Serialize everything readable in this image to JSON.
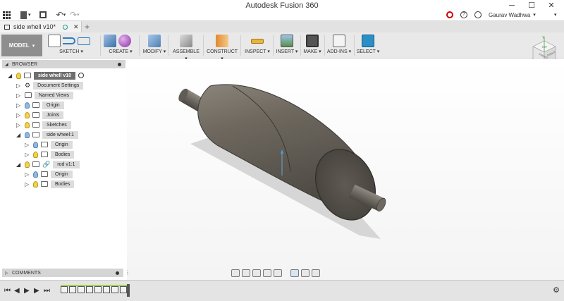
{
  "window": {
    "title": "Autodesk Fusion 360",
    "controls": [
      "minimize",
      "maximize",
      "close"
    ]
  },
  "user": {
    "name": "Gaurav Wadhwa"
  },
  "tabs": [
    {
      "label": "side whell v10*"
    }
  ],
  "toolbar": {
    "workspace": "MODEL",
    "groups": [
      {
        "label": "SKETCH"
      },
      {
        "label": "CREATE"
      },
      {
        "label": "MODIFY"
      },
      {
        "label": "ASSEMBLE"
      },
      {
        "label": "CONSTRUCT"
      },
      {
        "label": "INSPECT"
      },
      {
        "label": "INSERT"
      },
      {
        "label": "MAKE"
      },
      {
        "label": "ADD-INS"
      },
      {
        "label": "SELECT"
      }
    ]
  },
  "browser": {
    "title": "BROWSER",
    "root": "side whell v10",
    "items": [
      {
        "label": "Document Settings"
      },
      {
        "label": "Named Views"
      },
      {
        "label": "Origin"
      },
      {
        "label": "Joints"
      },
      {
        "label": "Sketches"
      },
      {
        "label": "side wheel:1"
      },
      {
        "label": "Origin"
      },
      {
        "label": "Bodies"
      },
      {
        "label": "rod v1:1"
      },
      {
        "label": "Origin"
      },
      {
        "label": "Bodies"
      }
    ]
  },
  "comments": {
    "title": "COMMENTS"
  },
  "viewcube": {
    "faces": [
      "FRONT",
      "RIGHT",
      "TOP"
    ],
    "axes": [
      "X",
      "Y",
      "Z"
    ]
  },
  "colors": {
    "accent": "#1e90c8",
    "workspace_bg": "#8e8e8e",
    "body": "#6b655c"
  }
}
